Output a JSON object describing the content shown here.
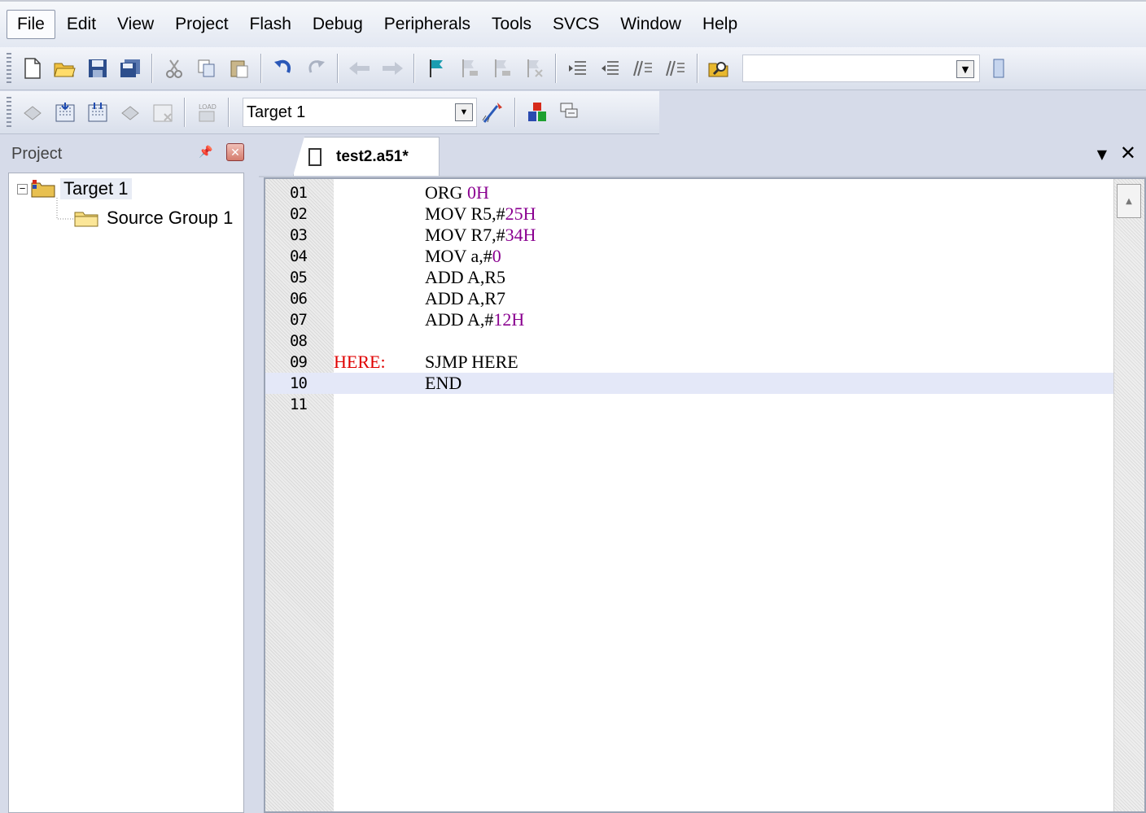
{
  "menu": {
    "items": [
      "File",
      "Edit",
      "View",
      "Project",
      "Flash",
      "Debug",
      "Peripherals",
      "Tools",
      "SVCS",
      "Window",
      "Help"
    ]
  },
  "toolbar1": {
    "icons": [
      "new-file-icon",
      "open-folder-icon",
      "save-icon",
      "save-all-icon",
      "cut-icon",
      "copy-icon",
      "paste-icon",
      "undo-icon",
      "redo-icon",
      "navigate-back-icon",
      "navigate-forward-icon",
      "bookmark-icon",
      "prev-bookmark-icon",
      "next-bookmark-icon",
      "clear-bookmarks-icon",
      "indent-icon",
      "unindent-icon",
      "comment-icon",
      "uncomment-icon",
      "find-in-files-icon"
    ],
    "find_value": ""
  },
  "toolbar2": {
    "icons": [
      "translate-icon",
      "build-icon",
      "rebuild-icon",
      "batch-build-icon",
      "stop-build-icon",
      "download-icon",
      "target-options-icon",
      "manage-components-icon",
      "select-packs-icon"
    ],
    "target_value": "Target 1"
  },
  "project_panel": {
    "title": "Project",
    "tree": {
      "target": "Target 1",
      "expander": "−",
      "group": "Source Group 1"
    }
  },
  "editor": {
    "tab_title": "test2.a51*",
    "current_line": 10,
    "lines": [
      {
        "n": "01",
        "label": "",
        "op": "ORG ",
        "num": "0H",
        "rest": ""
      },
      {
        "n": "02",
        "label": "",
        "op": "MOV R5,#",
        "num": "25H",
        "rest": ""
      },
      {
        "n": "03",
        "label": "",
        "op": "MOV R7,#",
        "num": "34H",
        "rest": ""
      },
      {
        "n": "04",
        "label": "",
        "op": "MOV a,#",
        "num": "0",
        "rest": ""
      },
      {
        "n": "05",
        "label": "",
        "op": "ADD A,R5",
        "num": "",
        "rest": ""
      },
      {
        "n": "06",
        "label": "",
        "op": "ADD A,R7",
        "num": "",
        "rest": ""
      },
      {
        "n": "07",
        "label": "",
        "op": "ADD A,#",
        "num": "12H",
        "rest": ""
      },
      {
        "n": "08",
        "label": "",
        "op": "",
        "num": "",
        "rest": ""
      },
      {
        "n": "09",
        "label": "HERE:",
        "op": "SJMP HERE",
        "num": "",
        "rest": ""
      },
      {
        "n": "10",
        "label": "",
        "op": "END",
        "num": "",
        "rest": ""
      },
      {
        "n": "11",
        "label": "",
        "op": "",
        "num": "",
        "rest": ""
      }
    ]
  },
  "colors": {
    "label": "#e00000",
    "number": "#8a0090",
    "current_line_bg": "#e4e8f8",
    "chrome_bg": "#d6dbe9"
  }
}
